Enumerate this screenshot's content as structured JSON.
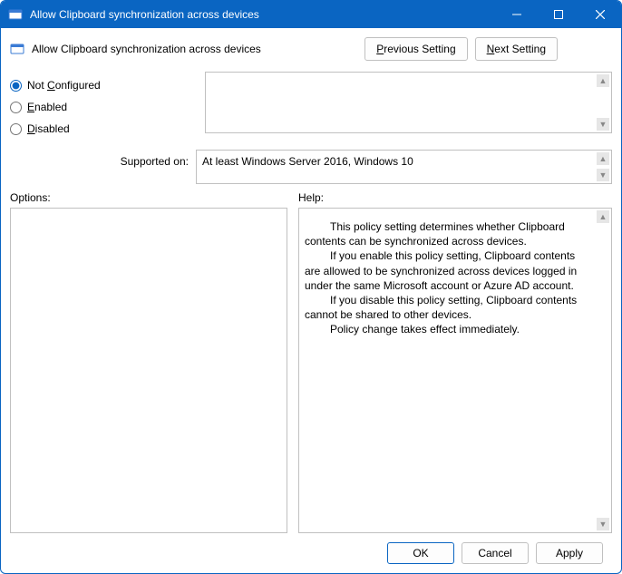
{
  "title": "Allow Clipboard synchronization across devices",
  "header": {
    "label": "Allow Clipboard synchronization across devices",
    "prev": "Previous Setting",
    "next": "Next Setting"
  },
  "state": {
    "not_configured": "Not Configured",
    "enabled": "Enabled",
    "disabled": "Disabled",
    "selected": "not_configured"
  },
  "supported": {
    "label": "Supported on:",
    "value": "At least Windows Server 2016, Windows 10"
  },
  "sections": {
    "options": "Options:",
    "help": "Help:"
  },
  "help": {
    "p1": "This policy setting determines whether Clipboard contents can be synchronized across devices.",
    "p2": "If you enable this policy setting, Clipboard contents are allowed to be synchronized across devices logged in under the same Microsoft account or Azure AD account.",
    "p3": "If you disable this policy setting, Clipboard contents cannot be shared to other devices.",
    "p4": "Policy change takes effect immediately."
  },
  "footer": {
    "ok": "OK",
    "cancel": "Cancel",
    "apply": "Apply"
  }
}
